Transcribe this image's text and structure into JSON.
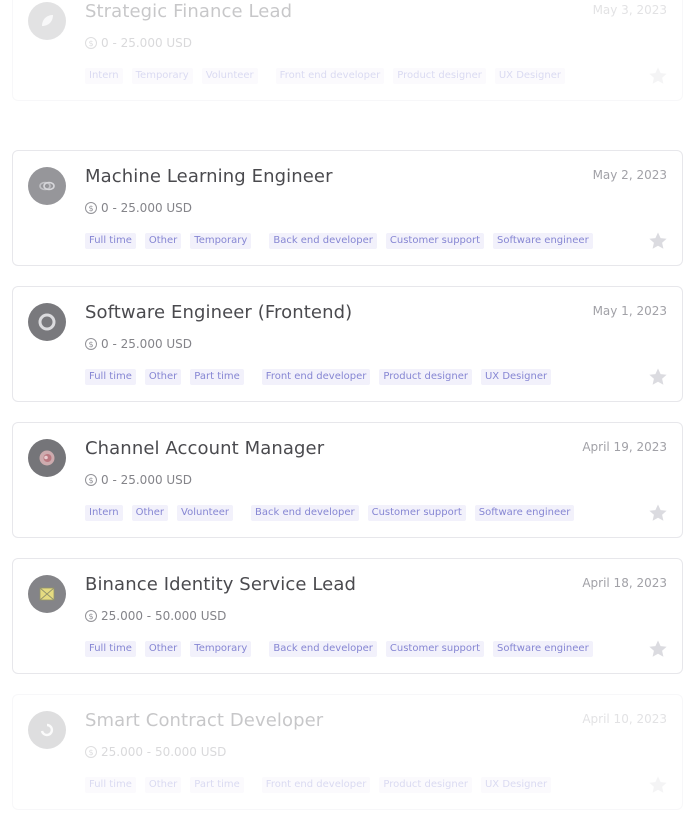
{
  "jobs": [
    {
      "title": "Strategic Finance Lead",
      "date": "May 3, 2023",
      "salary": "0 - 25.000 USD",
      "tags_type": [
        "Intern",
        "Temporary",
        "Volunteer"
      ],
      "tags_role": [
        "Front end developer",
        "Product designer",
        "UX Designer"
      ],
      "logo_icon": "leaf-icon"
    },
    {
      "title": "Machine Learning Engineer",
      "date": "May 2, 2023",
      "salary": "0 - 25.000 USD",
      "tags_type": [
        "Full time",
        "Other",
        "Temporary"
      ],
      "tags_role": [
        "Back end developer",
        "Customer support",
        "Software engineer"
      ],
      "logo_icon": "link-icon"
    },
    {
      "title": "Software Engineer (Frontend)",
      "date": "May 1, 2023",
      "salary": "0 - 25.000 USD",
      "tags_type": [
        "Full time",
        "Other",
        "Part time"
      ],
      "tags_role": [
        "Front end developer",
        "Product designer",
        "UX Designer"
      ],
      "logo_icon": "ring-icon"
    },
    {
      "title": "Channel Account Manager",
      "date": "April 19, 2023",
      "salary": "0 - 25.000 USD",
      "tags_type": [
        "Intern",
        "Other",
        "Volunteer"
      ],
      "tags_role": [
        "Back end developer",
        "Customer support",
        "Software engineer"
      ],
      "logo_icon": "swirl-icon"
    },
    {
      "title": "Binance Identity Service Lead",
      "date": "April 18, 2023",
      "salary": "25.000 - 50.000 USD",
      "tags_type": [
        "Full time",
        "Other",
        "Temporary"
      ],
      "tags_role": [
        "Back end developer",
        "Customer support",
        "Software engineer"
      ],
      "logo_icon": "envelope-icon"
    },
    {
      "title": "Smart Contract Developer",
      "date": "April 10, 2023",
      "salary": "25.000 - 50.000 USD",
      "tags_type": [
        "Full time",
        "Other",
        "Part time"
      ],
      "tags_role": [
        "Front end developer",
        "Product designer",
        "UX Designer"
      ],
      "logo_icon": "circle-arrow-icon"
    }
  ],
  "colors": {
    "tag_text": "#7c7cd0",
    "tag_bg": "#f1f0fb",
    "title": "#3b3b40",
    "star": "#d9d9de",
    "card_border": "#e6e6ea"
  }
}
